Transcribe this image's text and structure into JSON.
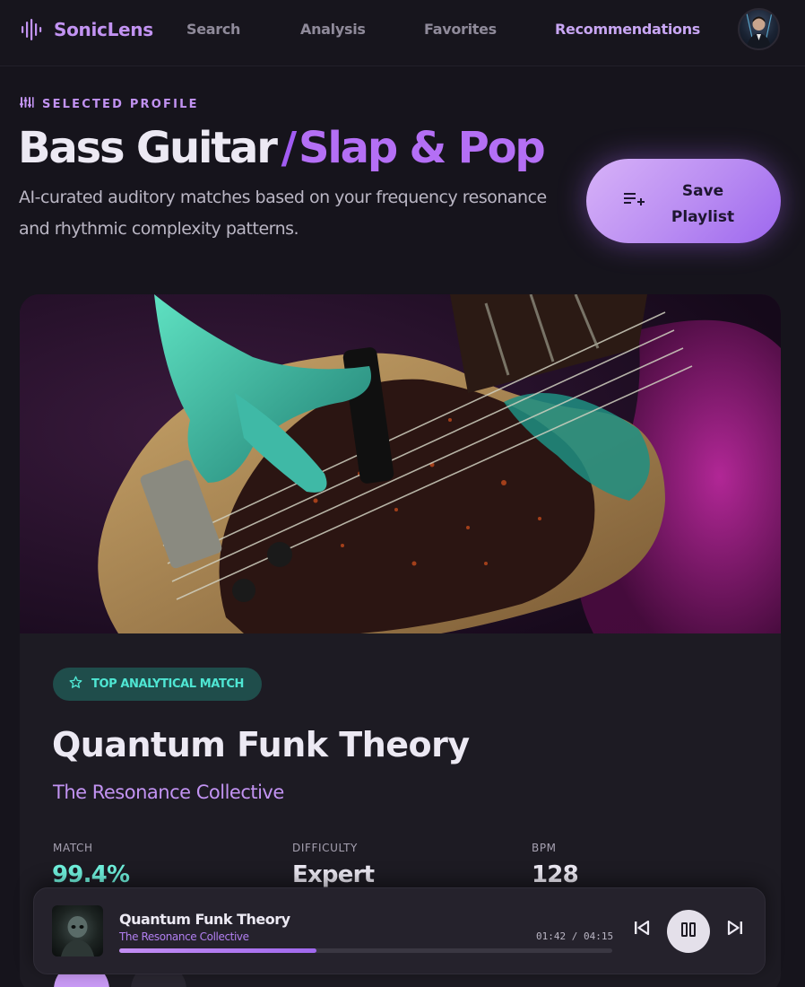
{
  "app": {
    "name": "SonicLens"
  },
  "nav": [
    {
      "label": "Search"
    },
    {
      "label": "Analysis"
    },
    {
      "label": "Favorites"
    },
    {
      "label": "Recommendations",
      "active": true
    }
  ],
  "profile": {
    "eyebrow": "SELECTED PROFILE",
    "instrument": "Bass Guitar",
    "separator": "/",
    "technique": "Slap & Pop",
    "description": "AI-curated auditory matches based on your frequency resonance and rhythmic complexity patterns.",
    "save_label_line1": "Save",
    "save_label_line2": "Playlist"
  },
  "card": {
    "badge": "TOP ANALYTICAL MATCH",
    "title": "Quantum Funk Theory",
    "artist": "The Resonance Collective",
    "stats": [
      {
        "label": "MATCH",
        "value": "99.4%"
      },
      {
        "label": "DIFFICULTY",
        "value": "Expert"
      },
      {
        "label": "BPM",
        "value": "128"
      }
    ]
  },
  "player": {
    "title": "Quantum Funk Theory",
    "artist": "The Resonance Collective",
    "elapsed": "01:42",
    "duration": "04:15",
    "time_separator": " / ",
    "progress": 0.4
  },
  "colors": {
    "accent": "#c293f2",
    "teal": "#4fe6d3",
    "background": "#16141c"
  },
  "icons": {
    "brand": "waveform-icon",
    "save": "playlist-add-icon",
    "badge": "star-icon",
    "prev": "skip-previous-icon",
    "pause": "pause-icon",
    "next": "skip-next-icon"
  }
}
